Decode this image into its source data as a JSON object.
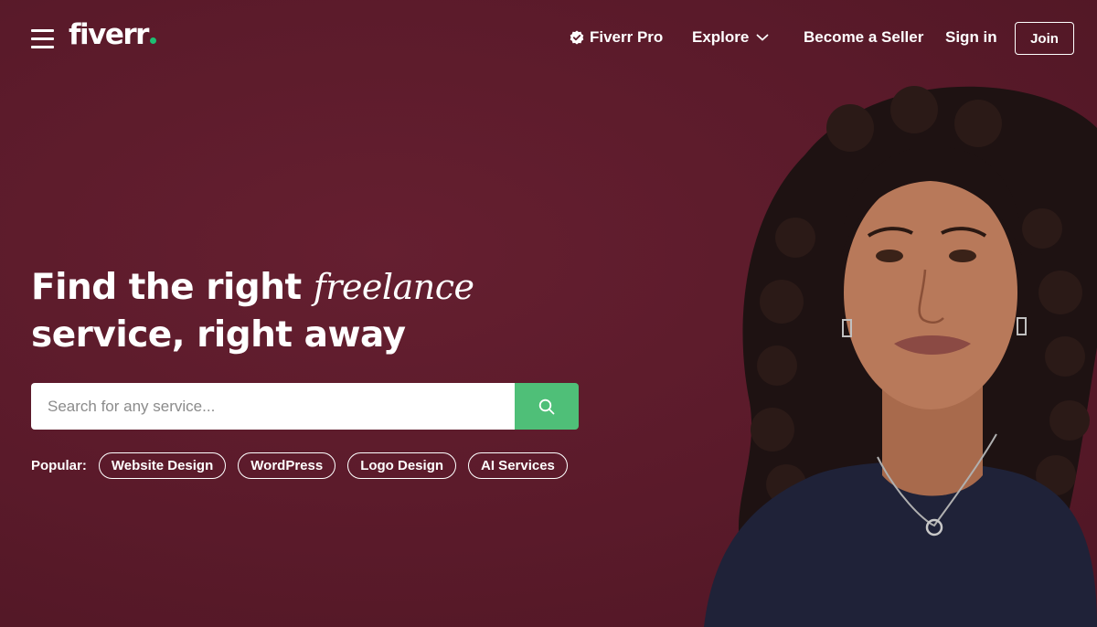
{
  "header": {
    "logo": "fiverr",
    "nav": {
      "pro_label": "Fiverr Pro",
      "explore_label": "Explore",
      "become_seller_label": "Become a Seller",
      "sign_in_label": "Sign in",
      "join_label": "Join"
    },
    "icons": {
      "menu": "hamburger-menu-icon",
      "pro_badge": "verified-badge-icon",
      "explore_caret": "chevron-down-icon"
    }
  },
  "hero": {
    "headline_part1": "Find the right ",
    "headline_italic": "freelance",
    "headline_part2": "service, right away",
    "search": {
      "placeholder": "Search for any service...",
      "value": "",
      "button_icon": "search-icon"
    },
    "popular": {
      "label": "Popular:",
      "tags": [
        "Website Design",
        "WordPress",
        "Logo Design",
        "AI Services"
      ]
    }
  },
  "colors": {
    "background": "#5b1b2b",
    "brand_green": "#1dbf73",
    "search_button": "#4fbf78",
    "text": "#ffffff"
  }
}
